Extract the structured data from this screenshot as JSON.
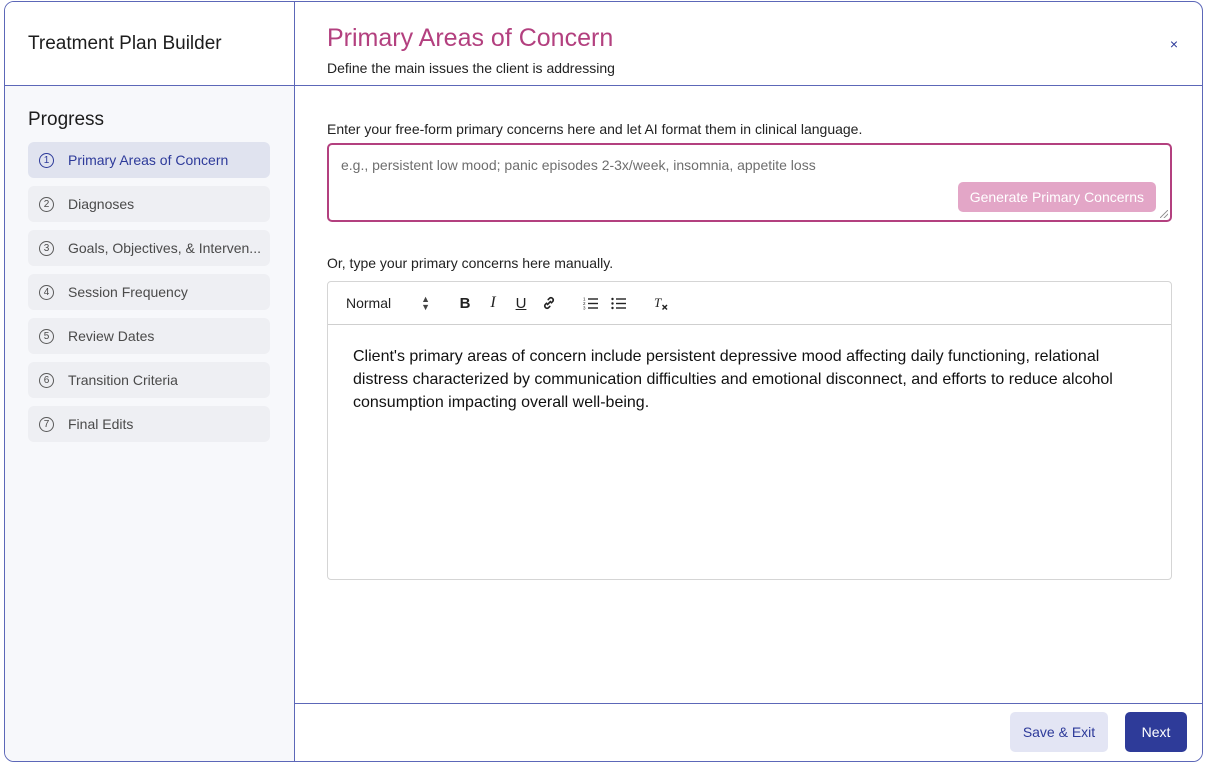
{
  "app": {
    "title": "Treatment Plan Builder"
  },
  "progress": {
    "title": "Progress",
    "steps": [
      {
        "num": "1",
        "label": "Primary Areas of Concern",
        "active": true
      },
      {
        "num": "2",
        "label": "Diagnoses",
        "active": false
      },
      {
        "num": "3",
        "label": "Goals, Objectives, & Interven...",
        "active": false
      },
      {
        "num": "4",
        "label": "Session Frequency",
        "active": false
      },
      {
        "num": "5",
        "label": "Review Dates",
        "active": false
      },
      {
        "num": "6",
        "label": "Transition Criteria",
        "active": false
      },
      {
        "num": "7",
        "label": "Final Edits",
        "active": false
      }
    ]
  },
  "header": {
    "title": "Primary Areas of Concern",
    "subtitle": "Define the main issues the client is addressing",
    "close_label": "×"
  },
  "ai_section": {
    "label": "Enter your free-form primary concerns here and let AI format them in clinical language.",
    "placeholder": "e.g., persistent low mood; panic episodes 2-3x/week, insomnia, appetite loss",
    "value": "",
    "button_label": "Generate Primary Concerns"
  },
  "manual_section": {
    "label": "Or, type your primary concerns here manually.",
    "toolbar": {
      "format_select": "Normal",
      "bold": "B",
      "italic": "I",
      "underline": "U",
      "link": "🔗",
      "ordered_list": "☰",
      "bullet_list": "☰",
      "clear_format": "Tx"
    },
    "content": "Client's primary areas of concern include persistent depressive mood affecting daily functioning, relational distress characterized by communication difficulties and emotional disconnect, and efforts to reduce alcohol consumption impacting overall well-being."
  },
  "footer": {
    "save_label": "Save & Exit",
    "next_label": "Next"
  },
  "colors": {
    "accent_pink": "#b3407f",
    "primary_blue": "#2e3b99",
    "border_blue": "#5c67b8",
    "disabled_pink": "#e3a6c7"
  }
}
